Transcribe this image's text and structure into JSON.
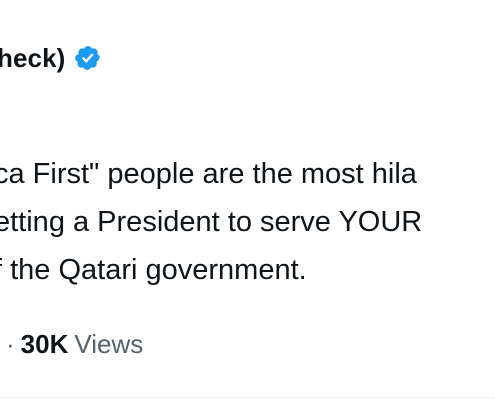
{
  "author": {
    "name_fragment": "heck)",
    "verified_icon": "verified-badge-icon",
    "verified_color": "#1d9bf0"
  },
  "tweet": {
    "lines": [
      "ca First\" people are the most hila",
      "etting a President to serve YOUR",
      "f the Qatari government."
    ]
  },
  "meta": {
    "separator": "·",
    "views_count": "30K",
    "views_label": "Views"
  },
  "colors": {
    "text_primary": "#0f1419",
    "text_secondary": "#536471",
    "background": "#ffffff"
  }
}
